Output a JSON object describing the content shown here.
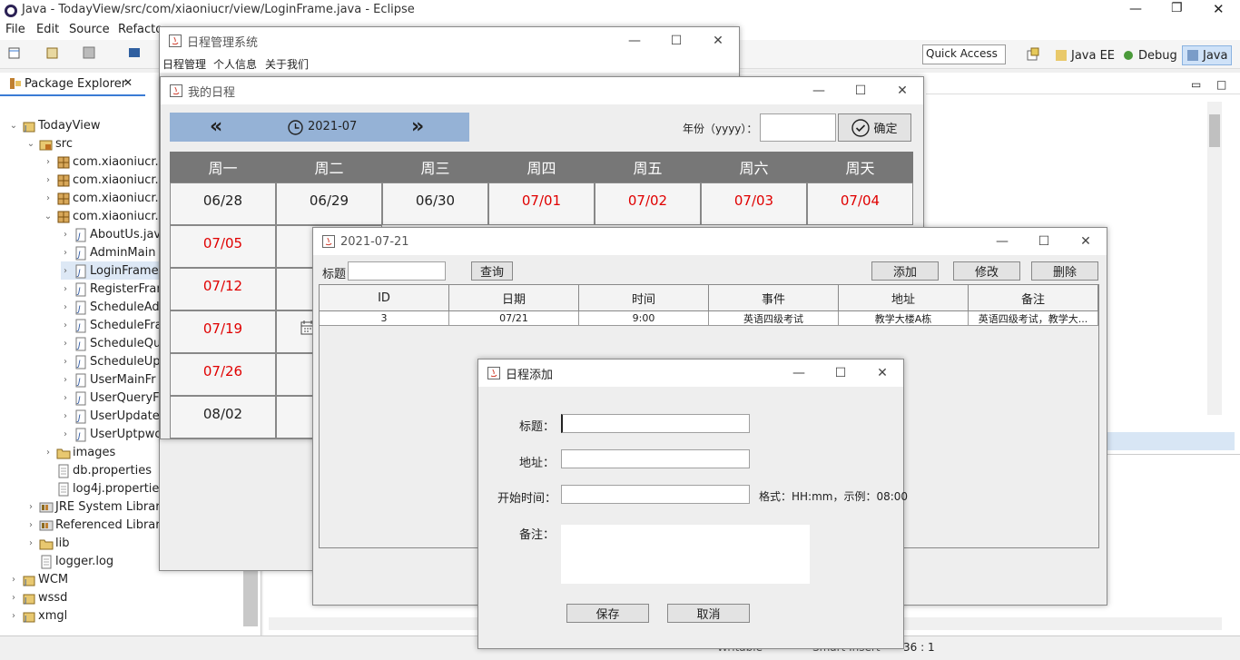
{
  "eclipse": {
    "title": "Java - TodayView/src/com/xiaoniucr/view/LoginFrame.java - Eclipse",
    "menu": [
      "File",
      "Edit",
      "Source",
      "Refacto"
    ],
    "quick_access": "Quick Access",
    "perspectives": [
      "Java EE",
      "Debug",
      "Java"
    ],
    "package_explorer_tab": "Package Explorer",
    "status": [
      "Writable",
      "Smart Insert",
      "36 : 1"
    ]
  },
  "tree": [
    {
      "label": "TodayView",
      "depth": 0,
      "arrow": "⌄",
      "icon": "project-icon"
    },
    {
      "label": "src",
      "depth": 1,
      "arrow": "⌄",
      "icon": "src-folder-icon"
    },
    {
      "label": "com.xiaoniucr.c",
      "depth": 2,
      "arrow": "›",
      "icon": "package-icon"
    },
    {
      "label": "com.xiaoniucr.r",
      "depth": 2,
      "arrow": "›",
      "icon": "package-icon"
    },
    {
      "label": "com.xiaoniucr.u",
      "depth": 2,
      "arrow": "›",
      "icon": "package-icon"
    },
    {
      "label": "com.xiaoniucr.v",
      "depth": 2,
      "arrow": "⌄",
      "icon": "package-icon"
    },
    {
      "label": "AboutUs.jav",
      "depth": 3,
      "arrow": "›",
      "icon": "java-file-icon"
    },
    {
      "label": "AdminMain",
      "depth": 3,
      "arrow": "›",
      "icon": "java-file-icon"
    },
    {
      "label": "LoginFrame",
      "depth": 3,
      "arrow": "›",
      "icon": "java-file-icon"
    },
    {
      "label": "RegisterFrar",
      "depth": 3,
      "arrow": "›",
      "icon": "java-file-icon"
    },
    {
      "label": "ScheduleAd",
      "depth": 3,
      "arrow": "›",
      "icon": "java-file-icon"
    },
    {
      "label": "ScheduleFra",
      "depth": 3,
      "arrow": "›",
      "icon": "java-file-icon"
    },
    {
      "label": "ScheduleQu",
      "depth": 3,
      "arrow": "›",
      "icon": "java-file-icon"
    },
    {
      "label": "ScheduleUp",
      "depth": 3,
      "arrow": "›",
      "icon": "java-file-icon"
    },
    {
      "label": "UserMainFr",
      "depth": 3,
      "arrow": "›",
      "icon": "java-file-icon"
    },
    {
      "label": "UserQueryF",
      "depth": 3,
      "arrow": "›",
      "icon": "java-file-icon"
    },
    {
      "label": "UserUpdate",
      "depth": 3,
      "arrow": "›",
      "icon": "java-file-icon"
    },
    {
      "label": "UserUptpwc",
      "depth": 3,
      "arrow": "›",
      "icon": "java-file-icon"
    },
    {
      "label": "images",
      "depth": 2,
      "arrow": "›",
      "icon": "folder-icon"
    },
    {
      "label": "db.properties",
      "depth": 2,
      "arrow": "",
      "icon": "file-icon"
    },
    {
      "label": "log4j.propertie",
      "depth": 2,
      "arrow": "",
      "icon": "file-icon"
    },
    {
      "label": "JRE System Library",
      "depth": 1,
      "arrow": "›",
      "icon": "library-icon"
    },
    {
      "label": "Referenced Librari",
      "depth": 1,
      "arrow": "›",
      "icon": "library-icon"
    },
    {
      "label": "lib",
      "depth": 1,
      "arrow": "›",
      "icon": "folder-icon"
    },
    {
      "label": "logger.log",
      "depth": 1,
      "arrow": "",
      "icon": "file-icon"
    },
    {
      "label": "WCM",
      "depth": 0,
      "arrow": "›",
      "icon": "project-icon"
    },
    {
      "label": "wssd",
      "depth": 0,
      "arrow": "›",
      "icon": "project-icon"
    },
    {
      "label": "xmgl",
      "depth": 0,
      "arrow": "›",
      "icon": "project-icon"
    }
  ],
  "main_window": {
    "title": "日程管理系统",
    "menu": [
      "日程管理",
      "个人信息",
      "关于我们"
    ]
  },
  "calendar_window": {
    "title": "我的日程",
    "month": "2021-07",
    "year_label": "年份（yyyy）：",
    "year_value": "",
    "confirm": "确定",
    "weekdays": [
      "周一",
      "周二",
      "周三",
      "周四",
      "周五",
      "周六",
      "周天"
    ],
    "row1": [
      "06/28",
      "06/29",
      "06/30",
      "07/01",
      "07/02",
      "07/03",
      "07/04"
    ],
    "col1": [
      "07/05",
      "07/12",
      "07/19",
      "07/26",
      "08/02"
    ],
    "row_colors": {
      "past": "#222222",
      "current": "#e00000"
    }
  },
  "day_window": {
    "title": "2021-07-21",
    "title_label": "标题",
    "title_value": "",
    "query": "查询",
    "add": "添加",
    "edit": "修改",
    "delete": "删除",
    "columns": [
      "ID",
      "日期",
      "时间",
      "事件",
      "地址",
      "备注"
    ],
    "rows": [
      [
        "3",
        "07/21",
        "9:00",
        "英语四级考试",
        "教学大楼A栋",
        "英语四级考试，教学大..."
      ]
    ]
  },
  "add_dialog": {
    "title": "日程添加",
    "title_label": "标题：",
    "address_label": "地址：",
    "start_label": "开始时间：",
    "format_hint": "格式：HH:mm，示例：08:00",
    "remark_label": "备注：",
    "save": "保存",
    "cancel": "取消"
  }
}
